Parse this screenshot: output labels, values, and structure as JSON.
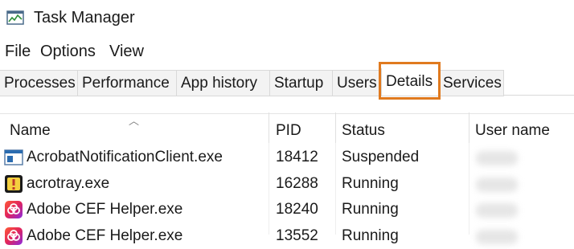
{
  "window": {
    "title": "Task Manager",
    "icon": "task-manager-icon"
  },
  "menu": [
    "File",
    "Options",
    "View"
  ],
  "tabs": [
    {
      "label": "Processes"
    },
    {
      "label": "Performance"
    },
    {
      "label": "App history"
    },
    {
      "label": "Startup"
    },
    {
      "label": "Users"
    },
    {
      "label": "Details",
      "active": true
    },
    {
      "label": "Services"
    }
  ],
  "columns": {
    "name": "Name",
    "pid": "PID",
    "status": "Status",
    "user": "User name"
  },
  "rows": [
    {
      "icon": "acrobat-notification-icon",
      "name": "AcrobatNotificationClient.exe",
      "pid": "18412",
      "status": "Suspended"
    },
    {
      "icon": "acrotray-icon",
      "name": "acrotray.exe",
      "pid": "16288",
      "status": "Running"
    },
    {
      "icon": "adobe-cef-icon",
      "name": "Adobe CEF Helper.exe",
      "pid": "18240",
      "status": "Running"
    },
    {
      "icon": "adobe-cef-icon",
      "name": "Adobe CEF Helper.exe",
      "pid": "13552",
      "status": "Running"
    }
  ],
  "colors": {
    "highlight": "#e07a1f",
    "tab_bg": "#f3f3f3"
  }
}
